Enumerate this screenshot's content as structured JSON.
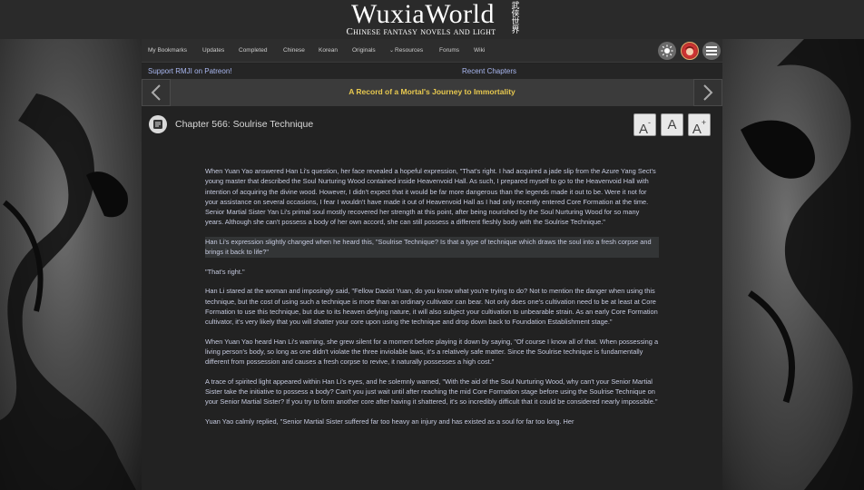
{
  "header": {
    "logo_title": "WuxiaWorld",
    "logo_subtitle": "Chinese fantasy novels and light novels!",
    "logo_cn": "武侠世界"
  },
  "nav": {
    "items": [
      {
        "label": "My Bookmarks"
      },
      {
        "label": "Updates"
      },
      {
        "label": "Completed"
      },
      {
        "label": "Chinese"
      },
      {
        "label": "Korean"
      },
      {
        "label": "Originals"
      },
      {
        "label": "Resources"
      },
      {
        "label": "Forums"
      },
      {
        "label": "Wiki"
      }
    ],
    "icons": {
      "theme": "sun-icon",
      "avatar": "avatar",
      "menu": "menu-icon"
    }
  },
  "subbar": {
    "patreon_link": "Support RMJI on Patreon!",
    "recent_link": "Recent Chapters"
  },
  "novel": {
    "title": "A Record of a Mortal's Journey to Immortality"
  },
  "chapter": {
    "title": "Chapter 566: Soulrise Technique",
    "font_buttons": {
      "decrease": "A",
      "reset": "A",
      "increase": "A",
      "minus": "-",
      "plus": "+"
    }
  },
  "paragraphs": [
    "When Yuan Yao answered Han Li's question, her face revealed a hopeful expression, \"That's right. I had acquired a jade slip from the Azure Yang Sect's young master that described the Soul Nurturing Wood contained inside Heavenvoid Hall. As such, I prepared myself to go to the Heavenvoid Hall with intention of acquiring the divine wood. However, I didn't expect that it would be far more dangerous than the legends made it out to be. Were it not for your assistance on several occasions, I fear I wouldn't have made it out of Heavenvoid Hall as I had only recently entered Core Formation at the time. Senior Martial Sister Yan Li's primal soul mostly recovered her strength at this point, after being nourished by the Soul Nurturing Wood for so many years. Although she can't possess a body of her own accord, she can still possess a different fleshly body with the Soulrise Technique.\"",
    "Han Li's expression slightly changed when he heard this, \"Soulrise Technique? Is that a type of technique which draws the soul into a fresh corpse and brings it back to life?\"",
    "\"That's right.\"",
    "Han Li stared at the woman and imposingly said, \"Fellow Daoist Yuan, do you know what you're trying to do? Not to mention the danger when using this technique, but the cost of using such a technique is more than an ordinary cultivator can bear. Not only does one's cultivation need to be at least at Core Formation to use this technique, but due to its heaven defying nature, it will also subject your cultivation to unbearable strain. As an early Core Formation cultivator, it's very likely that you will shatter your core upon using the technique and drop down back to Foundation Establishment stage.\"",
    "When Yuan Yao heard Han Li's warning, she grew silent for a moment before playing it down by saying, \"Of course I know all of that. When possessing a living person's body, so long as one didn't violate the three inviolable laws, it's a relatively safe matter. Since the Soulrise technique is fundamentally different from possession and causes a fresh corpse to revive, it naturally possesses a high cost.\"",
    "A trace of spirited light appeared within Han Li's eyes, and he solemnly warned, \"With the aid of the Soul Nurturing Wood, why can't your Senior Martial Sister take the initiative to possess a body? Can't you just wait until after reaching the mid Core Formation stage before using the Soulrise Technique on your Senior Martial Sister? If you try to form another core after having it shattered, it's so incredibly difficult that it could be considered nearly impossible.\"",
    "Yuan Yao calmly replied, \"Senior Martial Sister suffered far too heavy an injury and has existed as a soul for far too long. Her"
  ]
}
